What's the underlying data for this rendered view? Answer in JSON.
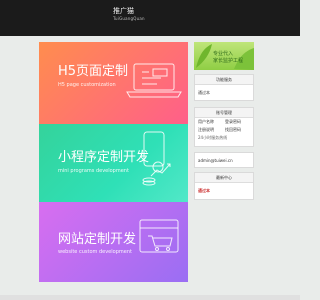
{
  "header": {
    "brand_name": "推广猫",
    "brand_pinyin": "TuiGuangQuan"
  },
  "banners": [
    {
      "title": "H5页面定制",
      "subtitle": "H5 page customization"
    },
    {
      "title": "小程序定制开发",
      "subtitle": "mini programs development"
    },
    {
      "title": "网站定制开发",
      "subtitle": "website custom development"
    }
  ],
  "sidebar": {
    "ad_line1": "专业代入",
    "ad_line2": "家长监护工程",
    "notice": {
      "title": "功能服务",
      "text": "通过本"
    },
    "account": {
      "title": "账号管理",
      "items": [
        {
          "a": "用户名称",
          "b": "登录密码"
        },
        {
          "a": "注册说明",
          "b": "找回密码"
        }
      ],
      "note": "24小时服务热线"
    },
    "contact": {
      "value": "admin@tuiwei.cn"
    },
    "news": {
      "title": "最新中心",
      "text": "通过本"
    }
  },
  "colors": {
    "h5_banner": "#ff7d64",
    "mini_banner": "#34d8a6",
    "web_banner": "#c36ef1",
    "topbar": "#1b1b1b"
  }
}
